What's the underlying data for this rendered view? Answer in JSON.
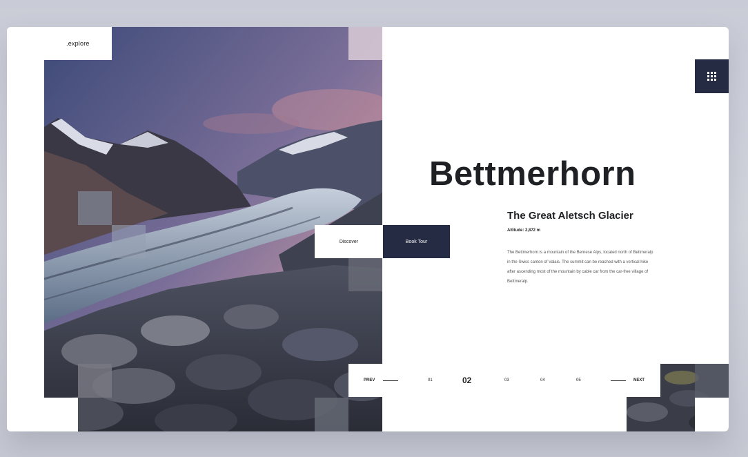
{
  "brand": {
    "logo_text": ".explore"
  },
  "menu": {
    "icon": "grid-menu-icon"
  },
  "hero": {
    "title": "Bettmerhorn",
    "subtitle": "The Great Aletsch Glacier",
    "altitude": "Altitude: 2,872 m",
    "description": "The Bettmerhorn is a mountain of the Bernese Alps, located north of Bettmeralp in the Swiss canton of Valais. The summit can be reached with a vertical hike after ascending most of the mountain by cable car from the car-free village of Bettmeralp."
  },
  "actions": {
    "discover_label": "Discover",
    "book_label": "Book Tour"
  },
  "pagination": {
    "prev_label": "PREV",
    "next_label": "NEXT",
    "pages": [
      "01",
      "02",
      "03",
      "04",
      "05"
    ],
    "active": "02"
  },
  "colors": {
    "accent": "#262b44",
    "background": "#ffffff",
    "page_bg": "#ccced8"
  }
}
